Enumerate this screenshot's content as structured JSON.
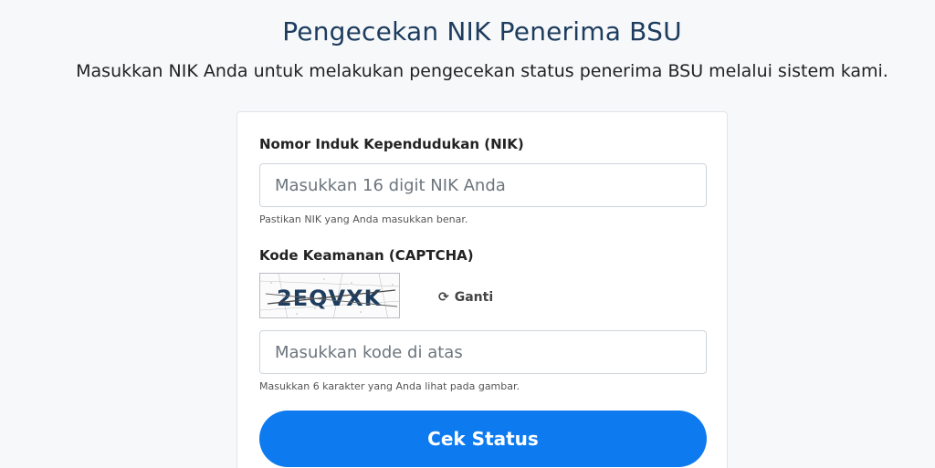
{
  "header": {
    "title": "Pengecekan NIK Penerima BSU",
    "subtitle": "Masukkan NIK Anda untuk melakukan pengecekan status penerima BSU melalui sistem kami."
  },
  "form": {
    "nik": {
      "label": "Nomor Induk Kependudukan (NIK)",
      "placeholder": "Masukkan 16 digit NIK Anda",
      "value": "",
      "help": "Pastikan NIK yang Anda masukkan benar."
    },
    "captcha": {
      "label": "Kode Keamanan (CAPTCHA)",
      "code": "2EQVXK",
      "refresh_label": "Ganti",
      "refresh_icon": "refresh-icon",
      "placeholder": "Masukkan kode di atas",
      "value": "",
      "help": "Masukkan 6 karakter yang Anda lihat pada gambar."
    },
    "submit_label": "Cek Status"
  },
  "colors": {
    "accent": "#0d7bef",
    "title": "#1d3c5e",
    "background": "#f7f8fa"
  }
}
